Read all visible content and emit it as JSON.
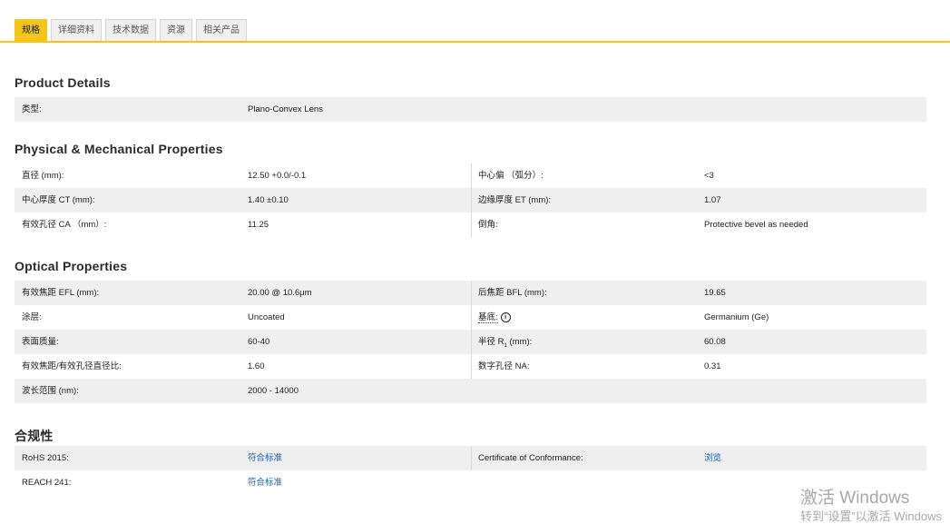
{
  "tabs": [
    "规格",
    "详细资料",
    "技术数据",
    "资源",
    "相关产品"
  ],
  "product_details": {
    "title": "Product Details",
    "rows": [
      {
        "label": "类型:",
        "value": "Plano-Convex Lens"
      }
    ]
  },
  "physical": {
    "title": "Physical & Mechanical Properties",
    "rows": [
      {
        "label1": "直径 (mm):",
        "value1": "12.50 +0.0/-0.1",
        "label2": "中心偏 （弧分）:",
        "value2": "<3"
      },
      {
        "label1": "中心厚度 CT (mm):",
        "value1": "1.40 ±0.10",
        "label2": "边缘厚度 ET (mm):",
        "value2": "1.07"
      },
      {
        "label1": "有效孔径 CA （mm）:",
        "value1": "11.25",
        "label2": "倒角:",
        "value2": "Protective bevel as needed"
      }
    ]
  },
  "optical": {
    "title": "Optical Properties",
    "rows": [
      {
        "label1": "有效焦距 EFL (mm):",
        "value1": "20.00 @ 10.6μm",
        "label2": "后焦距 BFL (mm):",
        "value2": "19.65"
      },
      {
        "label1": "涂层:",
        "value1": "Uncoated",
        "label2": "基底:",
        "value2": "Germanium (Ge)"
      },
      {
        "label1": "表面质量:",
        "value1": "60-40",
        "label2_prefix": "半径 R",
        "label2_sub": "1",
        "label2_suffix": " (mm):",
        "value2": "60.08"
      },
      {
        "label1": "有效焦距/有效孔径直径比:",
        "value1": "1.60",
        "label2": "数字孔径 NA:",
        "value2": "0.31"
      },
      {
        "label1": "波长范围 (nm):",
        "value1": "2000 - 14000"
      }
    ]
  },
  "compliance": {
    "title": "合规性",
    "rows": [
      {
        "label1": "RoHS 2015:",
        "value1": "符合标准",
        "label2": "Certificate of Conformance:",
        "value2": "浏览"
      },
      {
        "label1": "REACH 241:",
        "value1": "符合标准"
      }
    ]
  },
  "watermark": {
    "line1": "激活 Windows",
    "line2": "转到“设置”以激活 Windows"
  },
  "colors": {
    "accent": "#f5c518",
    "row_shade": "#efefef",
    "link": "#1a5ea8"
  }
}
